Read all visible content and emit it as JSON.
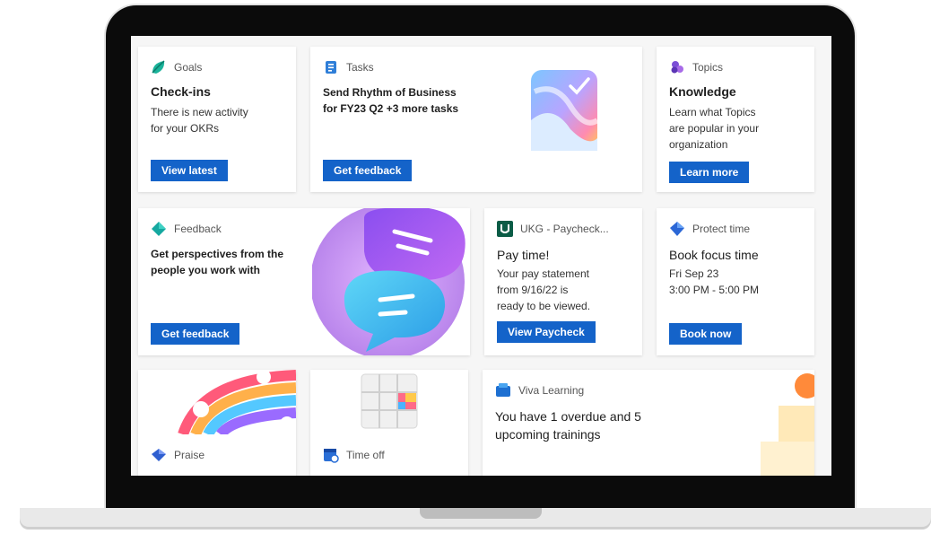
{
  "cards": {
    "goals": {
      "app": "Goals",
      "title": "Check-ins",
      "body1": "There is new activity",
      "body2": "for your OKRs",
      "button": "View latest"
    },
    "tasks": {
      "app": "Tasks",
      "body1": "Send Rhythm of Business",
      "body2": "for FY23 Q2 +3 more tasks",
      "button": "Get feedback"
    },
    "topics": {
      "app": "Topics",
      "title": "Knowledge",
      "body1": "Learn what Topics",
      "body2": "are popular in your",
      "body3": "organization",
      "button": "Learn more"
    },
    "feedback": {
      "app": "Feedback",
      "body1": "Get perspectives from the",
      "body2": "people you work with",
      "button": "Get feedback"
    },
    "ukg": {
      "app": "UKG - Paycheck...",
      "title": "Pay time!",
      "body1": "Your pay statement",
      "body2": "from 9/16/22 is",
      "body3": "ready to be viewed.",
      "button": "View Paycheck"
    },
    "protect": {
      "app": "Protect time",
      "title": "Book focus time",
      "body1": "Fri Sep 23",
      "body2": "3:00 PM - 5:00 PM",
      "button": "Book now"
    },
    "praise": {
      "app": "Praise"
    },
    "timeoff": {
      "app": "Time off"
    },
    "learning": {
      "app": "Viva Learning",
      "body1": "You have 1 overdue and 5",
      "body2": "upcoming trainings"
    }
  },
  "colors": {
    "accent_button": "#1463c9"
  }
}
